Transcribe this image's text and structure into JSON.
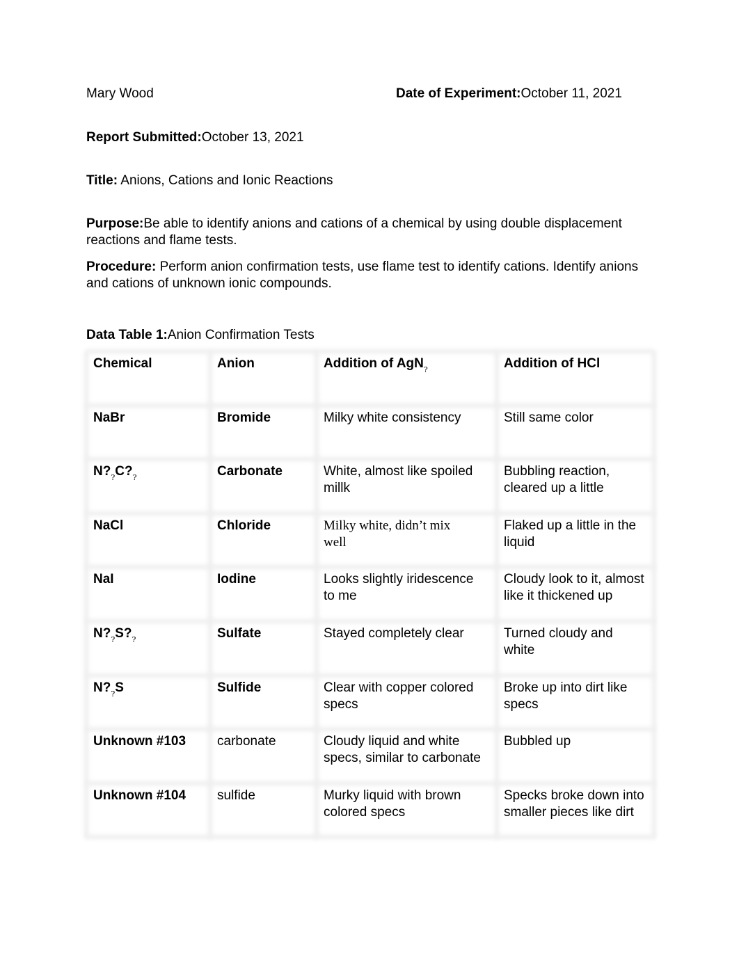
{
  "header": {
    "name": "Mary Wood",
    "date_label": "Date of Experiment:",
    "date_value": "October 11, 2021",
    "submitted_label": "Report Submitted:",
    "submitted_value": "October 13, 2021",
    "title_label": "Title:",
    "title_value": "Anions, Cations and Ionic Reactions",
    "purpose_label": "Purpose:",
    "purpose_line1": "Be able to identify anions and cations of a chemical by using double displacement",
    "purpose_line2": "reactions and flame tests.",
    "procedure_label": "Procedure:",
    "procedure_line1": "Perform anion confirmation tests, use flame test to identify cations. Identify anions",
    "procedure_line2": "and cations of unknown ionic compounds."
  },
  "table": {
    "caption_label": "Data Table 1:",
    "caption_text": "Anion Confirmation Tests",
    "headers": [
      [
        {
          "t": "Chemical"
        }
      ],
      [
        {
          "t": "Anion"
        }
      ],
      [
        {
          "t": "Addition of AgN"
        },
        {
          "t": "?",
          "sub": true
        }
      ],
      [
        {
          "t": "Addition of HCl"
        }
      ]
    ],
    "rows": [
      {
        "chemical": [
          {
            "t": "NaBr"
          }
        ],
        "anion": "Bromide",
        "anion_bold": true,
        "agno3": [
          "Milky white consistency"
        ],
        "hcl": [
          "Still same color"
        ]
      },
      {
        "chemical": [
          {
            "t": "N?"
          },
          {
            "t": "?",
            "sub": true
          },
          {
            "t": "C?"
          },
          {
            "t": "?",
            "sub": true
          }
        ],
        "anion": "Carbonate",
        "anion_bold": true,
        "agno3": [
          "White, almost like spoiled",
          "millk"
        ],
        "hcl": [
          "Bubbling reaction,",
          "cleared up a little"
        ]
      },
      {
        "chemical": [
          {
            "t": "NaCl"
          }
        ],
        "anion": "Chloride",
        "anion_bold": true,
        "agno3": [
          "Milky white, didn’t mix",
          "well"
        ],
        "agno3_serif": true,
        "hcl": [
          "Flaked up a little in the",
          "liquid"
        ]
      },
      {
        "chemical": [
          {
            "t": "NaI"
          }
        ],
        "anion": "Iodine",
        "anion_bold": true,
        "agno3": [
          "Looks slightly iridescence",
          "to me"
        ],
        "hcl": [
          "Cloudy look to it, almost",
          "like it thickened up"
        ]
      },
      {
        "chemical": [
          {
            "t": "N?"
          },
          {
            "t": "?",
            "sub": true
          },
          {
            "t": "S?"
          },
          {
            "t": "?",
            "sub": true
          }
        ],
        "anion": "Sulfate",
        "anion_bold": true,
        "agno3": [
          "Stayed completely clear"
        ],
        "hcl": [
          "Turned cloudy and",
          "white"
        ]
      },
      {
        "chemical": [
          {
            "t": "N?"
          },
          {
            "t": "?",
            "sub": true
          },
          {
            "t": "S"
          }
        ],
        "anion": "Sulfide",
        "anion_bold": true,
        "agno3": [
          "Clear with copper colored",
          "specs"
        ],
        "hcl": [
          "Broke up into dirt like",
          "specs"
        ]
      },
      {
        "chemical": [
          {
            "t": "Unknown #103"
          }
        ],
        "anion": "carbonate",
        "anion_bold": false,
        "agno3": [
          "Cloudy liquid and white",
          "specs, similar to carbonate"
        ],
        "hcl": [
          "Bubbled up"
        ]
      },
      {
        "chemical": [
          {
            "t": "Unknown #104"
          }
        ],
        "anion": "sulfide",
        "anion_bold": false,
        "agno3": [
          "Murky liquid with brown",
          "colored specs"
        ],
        "hcl": [
          "Specks broke down into",
          "smaller pieces like dirt"
        ]
      }
    ]
  }
}
